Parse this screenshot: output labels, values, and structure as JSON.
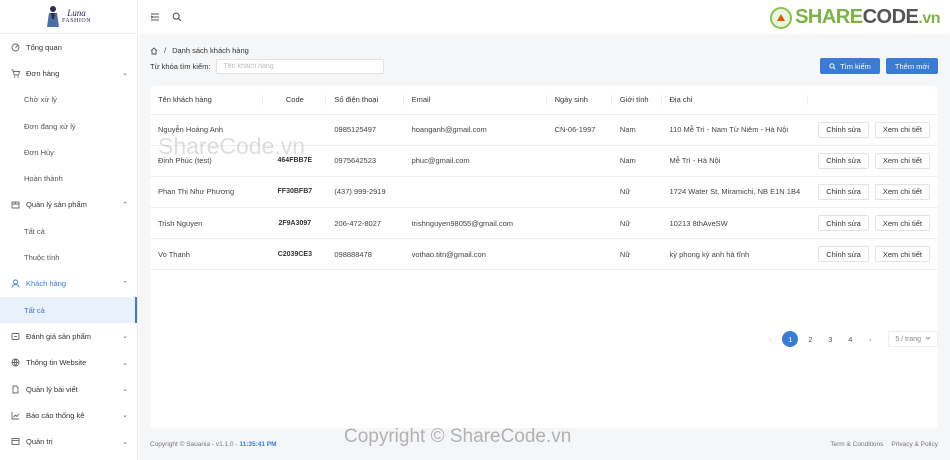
{
  "brand": {
    "logo_line1": "Luna",
    "logo_line2": "FASHION"
  },
  "sidebar": {
    "items": [
      {
        "label": "Tổng quan",
        "icon": "dashboard-icon",
        "sub": false,
        "chev": ""
      },
      {
        "label": "Đơn hàng",
        "icon": "cart-icon",
        "sub": false,
        "chev": "⌄"
      },
      {
        "label": "Chờ xử lý",
        "sub": true
      },
      {
        "label": "Đơn đang xử lý",
        "sub": true
      },
      {
        "label": "Đơn Hủy",
        "sub": true
      },
      {
        "label": "Hoàn thành",
        "sub": true
      },
      {
        "label": "Quản lý sản phẩm",
        "icon": "box-icon",
        "sub": false,
        "chev": "⌃"
      },
      {
        "label": "Tất cả",
        "sub": true
      },
      {
        "label": "Thuộc tính",
        "sub": true
      },
      {
        "label": "Khách hàng",
        "icon": "user-icon",
        "sub": false,
        "chev": "⌃",
        "active": true
      },
      {
        "label": "Tất cả",
        "sub": true,
        "active": true
      },
      {
        "label": "Đánh giá sản phẩm",
        "icon": "review-icon",
        "sub": false,
        "chev": "⌄"
      },
      {
        "label": "Thông tin Website",
        "icon": "globe-icon",
        "sub": false,
        "chev": "⌄"
      },
      {
        "label": "Quản lý bài viết",
        "icon": "file-icon",
        "sub": false,
        "chev": "⌄"
      },
      {
        "label": "Báo cáo thống kê",
        "icon": "chart-icon",
        "sub": false,
        "chev": "⌄"
      },
      {
        "label": "Quản trị",
        "icon": "settings-icon",
        "sub": false,
        "chev": "⌄"
      }
    ]
  },
  "watermark": {
    "share": "SHARE",
    "code": "CODE",
    "domain": ".vn",
    "middle": "ShareCode.vn",
    "copyright": "Copyright © ShareCode.vn"
  },
  "breadcrumb": {
    "separator": "/",
    "current": "Danh sách khách hàng"
  },
  "search": {
    "label": "Từ khóa tìm kiếm:",
    "placeholder": "Tên khách hàng",
    "value": ""
  },
  "buttons": {
    "search": "Tìm kiếm",
    "add": "Thêm mới"
  },
  "table": {
    "headers": [
      "Tên khách hàng",
      "Code",
      "Số điện thoại",
      "Email",
      "Ngày sinh",
      "Giới tính",
      "Địa chỉ",
      ""
    ],
    "rows": [
      {
        "name": "Nguyễn Hoàng Anh",
        "code": "",
        "phone": "0985125497",
        "email": "hoanganh@gmail.com",
        "dob": "CN-06-1997",
        "gender": "Nam",
        "address": "110 Mễ Trì - Nam Từ Niêm - Hà Nội"
      },
      {
        "name": "Đinh Phúc (test)",
        "code": "464FBB7E",
        "phone": "0975642523",
        "email": "phuc@gmail.com",
        "dob": "",
        "gender": "Nam",
        "address": "Mễ Trì - Hà Nội"
      },
      {
        "name": "Phan Thị Như Phương",
        "code": "FF30BFB7",
        "phone": "(437) 999-2919",
        "email": "",
        "dob": "",
        "gender": "Nữ",
        "address": "1724 Water St, Miramichi, NB E1N 1B4"
      },
      {
        "name": "Trish Nguyen",
        "code": "2F9A3097",
        "phone": "206-472-8027",
        "email": "trishnguyen98055@gmail.com",
        "dob": "",
        "gender": "Nữ",
        "address": "10213 8thAveSW"
      },
      {
        "name": "Vo Thanh",
        "code": "C2039CE3",
        "phone": "098888478",
        "email": "vothao.titn@gmail.con",
        "dob": "",
        "gender": "Nữ",
        "address": "kỳ phong kỳ anh hà tĩnh"
      }
    ],
    "edit_label": "Chỉnh sửa",
    "view_label": "Xem chi tiết"
  },
  "pagination": {
    "prev": "‹",
    "pages": [
      "1",
      "2",
      "3",
      "4"
    ],
    "current": "1",
    "next": "›",
    "per_page": "5 / trang"
  },
  "footer": {
    "copyright": "Copyright © Sauania - v1.1.0 - ",
    "time": "11:35:41 PM",
    "terms": "Term & Conditions",
    "privacy": "Privacy & Policy"
  },
  "colors": {
    "accent": "#3a7bd5",
    "wm_green": "#7cb342"
  }
}
